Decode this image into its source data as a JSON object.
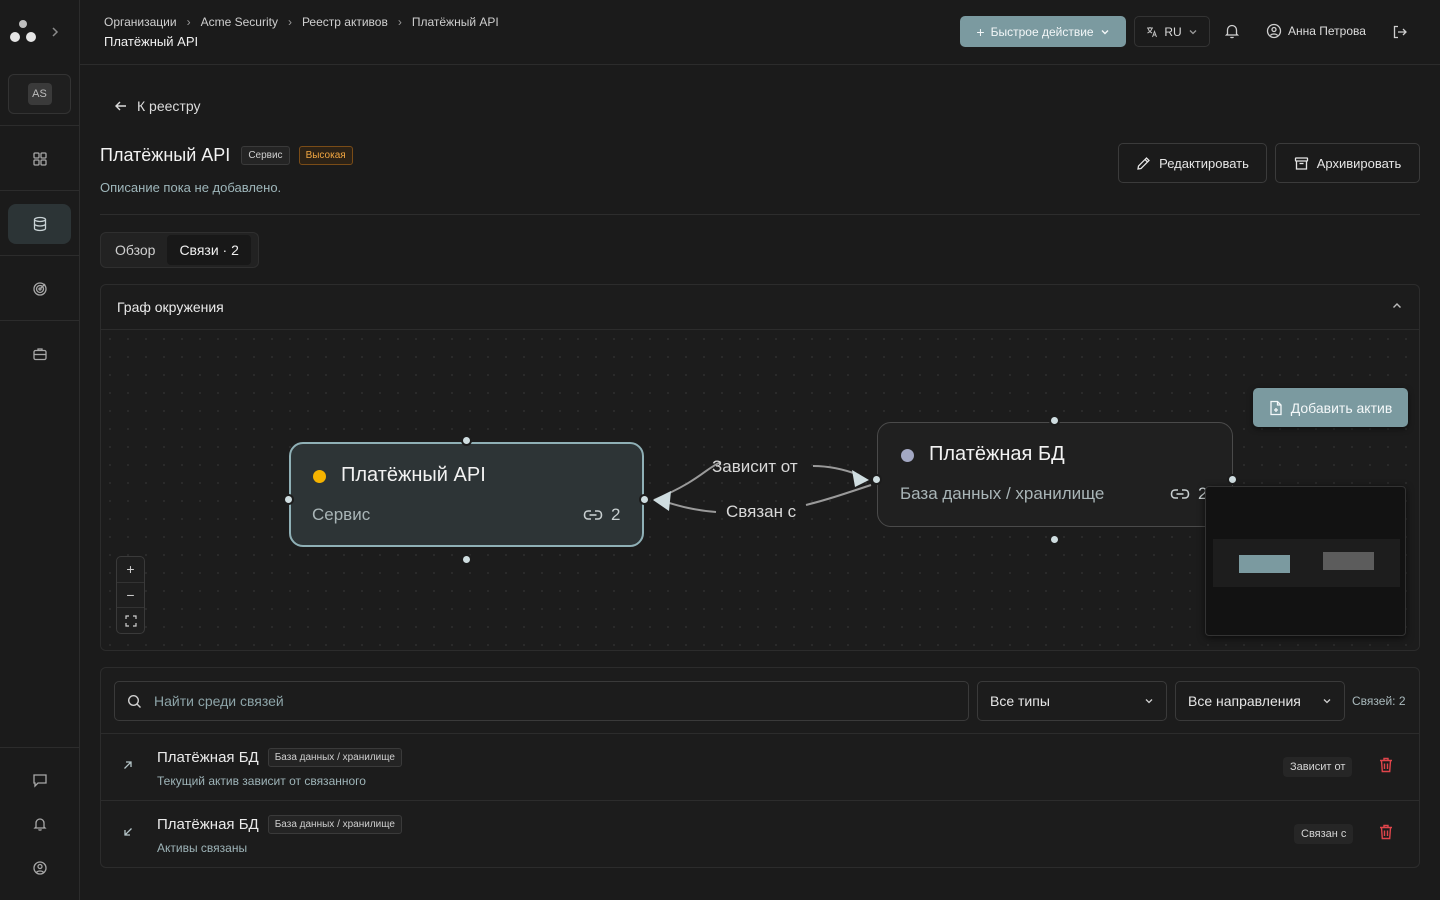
{
  "sidebar": {
    "org_initials": "AS",
    "nav": [
      {
        "id": "dashboard",
        "icon": "grid-icon",
        "active": false
      },
      {
        "id": "assets",
        "icon": "database-icon",
        "active": true
      },
      {
        "id": "targets",
        "icon": "target-icon",
        "active": false
      },
      {
        "id": "cases",
        "icon": "briefcase-icon",
        "active": false
      }
    ],
    "bottom": [
      "chat-icon",
      "bell-icon",
      "user-circle-icon"
    ]
  },
  "header": {
    "breadcrumbs": [
      "Организации",
      "Acme Security",
      "Реестр активов",
      "Платёжный API"
    ],
    "title": "Платёжный API",
    "quick_action": "Быстрое действие",
    "language": "RU",
    "user_name": "Анна Петрова"
  },
  "asset": {
    "back_label": "К реестру",
    "name": "Платёжный API",
    "type_badge": "Сервис",
    "criticality_badge": "Высокая",
    "description": "Описание пока не добавлено.",
    "edit_label": "Редактировать",
    "archive_label": "Архивировать"
  },
  "tabs": [
    {
      "label": "Обзор",
      "active": false
    },
    {
      "label": "Связи · 2",
      "active": true
    }
  ],
  "graph": {
    "title": "Граф окружения",
    "add_asset_label": "Добавить актив",
    "nodes": [
      {
        "name": "Платёжный API",
        "type": "Сервис",
        "links": "2",
        "dot_color": "#f5b300"
      },
      {
        "name": "Платёжная БД",
        "type": "База данных / хранилище",
        "links": "2",
        "dot_color": "#a3a8c3"
      }
    ],
    "edges": [
      "Зависит от",
      "Связан с"
    ],
    "zoom": [
      "+",
      "−"
    ]
  },
  "relations": {
    "search_placeholder": "Найти среди связей",
    "type_filter": "Все типы",
    "direction_filter": "Все направления",
    "count_label": "Связей: 2",
    "rows": [
      {
        "name": "Платёжная БД",
        "type": "База данных / хранилище",
        "description": "Текущий актив зависит от связанного",
        "relation": "Зависит от",
        "direction": "outgoing"
      },
      {
        "name": "Платёжная БД",
        "type": "База данных / хранилище",
        "description": "Активы связаны",
        "relation": "Связан с",
        "direction": "incoming"
      }
    ]
  },
  "colors": {
    "accent": "#7b9aa0",
    "danger": "#e0454b",
    "high": "#f0a540"
  }
}
